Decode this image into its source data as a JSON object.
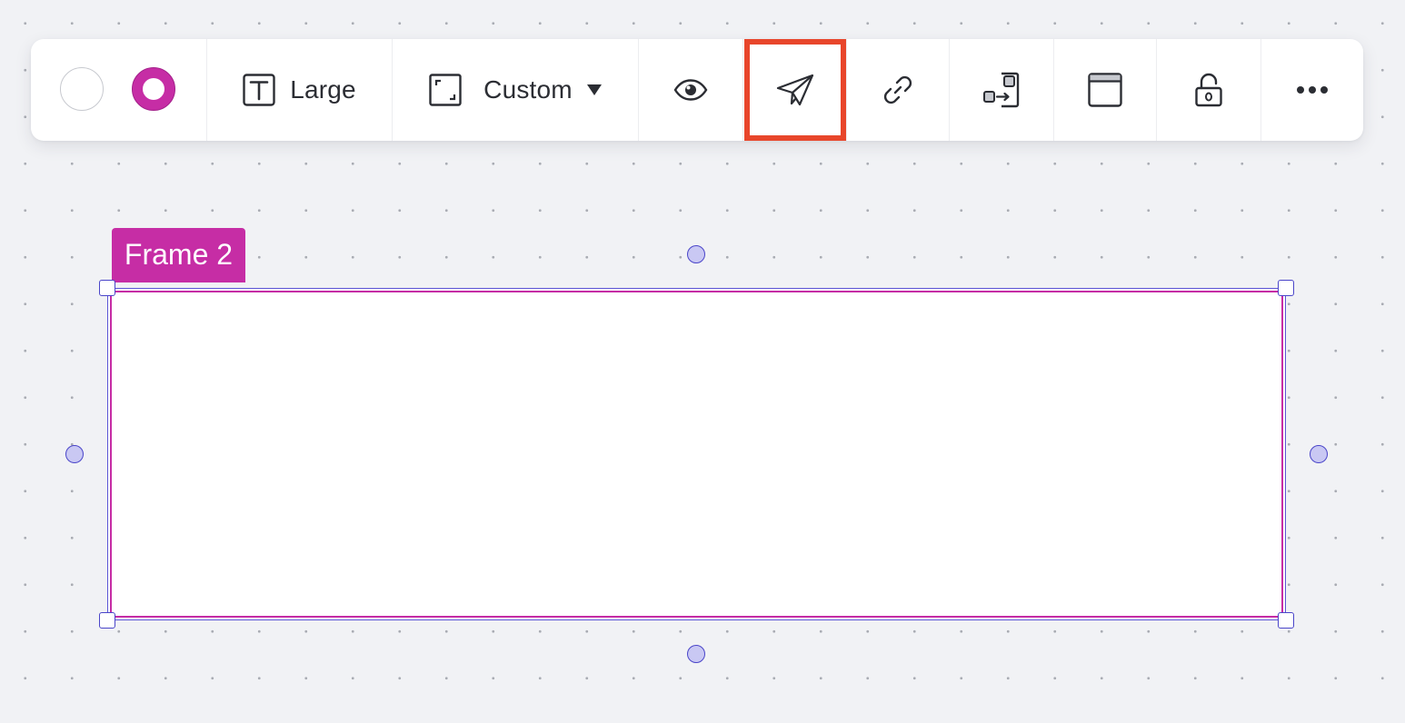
{
  "toolbar": {
    "colors": {
      "fill": "#ffffff",
      "stroke": "#c62da5",
      "highlight": "#e8462b"
    },
    "font_size_label": "Large",
    "frame_size_label": "Custom",
    "icons": {
      "fill_color": "white-circle",
      "border_color": "magenta-ring",
      "text_size": "text-t-icon",
      "frame_size": "frame-corners-icon",
      "dropdown": "caret-down-icon",
      "visibility": "eye-icon",
      "share": "paper-plane-icon",
      "link": "link-icon",
      "move": "move-to-frame-icon",
      "window": "window-icon",
      "lock": "unlock-icon",
      "more": "more-dots-icon"
    }
  },
  "frame": {
    "label": "Frame 2",
    "accent": "#c62da5",
    "selection": "#4a45c9"
  }
}
